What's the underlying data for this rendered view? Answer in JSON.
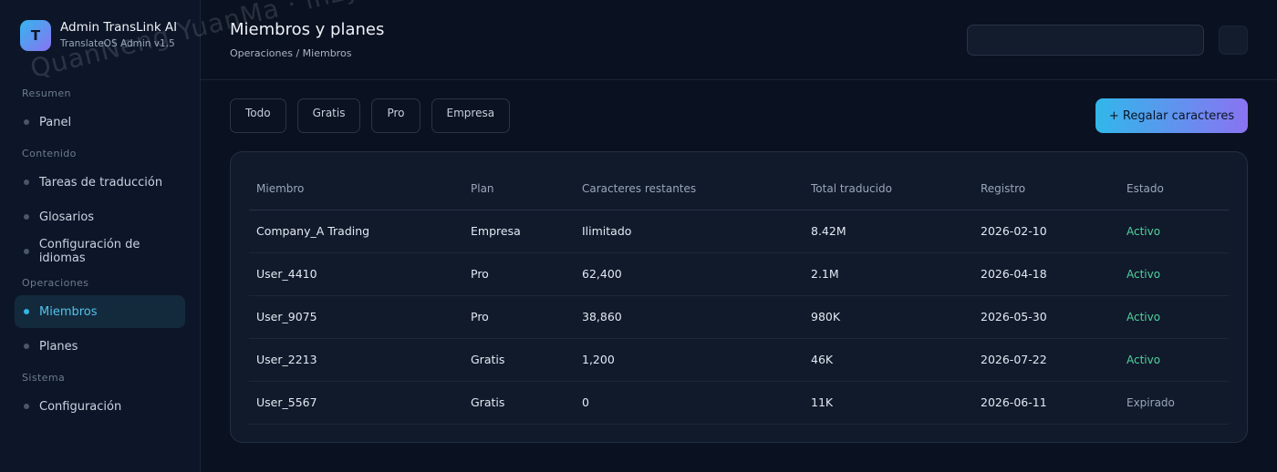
{
  "brand": {
    "logo_letter": "T",
    "title": "Admin TransLink AI",
    "subtitle": "TranslateOS Admin v1.5"
  },
  "sidebar": {
    "sections": [
      {
        "label": "Resumen",
        "items": [
          {
            "label": "Panel",
            "active": false
          }
        ]
      },
      {
        "label": "Contenido",
        "items": [
          {
            "label": "Tareas de traducción",
            "active": false
          },
          {
            "label": "Glosarios",
            "active": false
          },
          {
            "label": "Configuración de idiomas",
            "active": false
          }
        ]
      },
      {
        "label": "Operaciones",
        "items": [
          {
            "label": "Miembros",
            "active": true
          },
          {
            "label": "Planes",
            "active": false
          }
        ]
      },
      {
        "label": "Sistema",
        "items": [
          {
            "label": "Configuración",
            "active": false
          }
        ]
      }
    ]
  },
  "header": {
    "title": "Miembros y planes",
    "breadcrumb": "Operaciones / Miembros",
    "search_value": ""
  },
  "filters": [
    "Todo",
    "Gratis",
    "Pro",
    "Empresa"
  ],
  "gift_button_label": "+ Regalar caracteres",
  "table": {
    "columns": [
      "Miembro",
      "Plan",
      "Caracteres restantes",
      "Total traducido",
      "Registro",
      "Estado"
    ],
    "rows": [
      {
        "member": "Company_A Trading",
        "plan": "Empresa",
        "remaining": "Ilimitado",
        "total": "8.42M",
        "registered": "2026-02-10",
        "status": "Activo",
        "status_kind": "active"
      },
      {
        "member": "User_4410",
        "plan": "Pro",
        "remaining": "62,400",
        "total": "2.1M",
        "registered": "2026-04-18",
        "status": "Activo",
        "status_kind": "active"
      },
      {
        "member": "User_9075",
        "plan": "Pro",
        "remaining": "38,860",
        "total": "980K",
        "registered": "2026-05-30",
        "status": "Activo",
        "status_kind": "active"
      },
      {
        "member": "User_2213",
        "plan": "Gratis",
        "remaining": "1,200",
        "total": "46K",
        "registered": "2026-07-22",
        "status": "Activo",
        "status_kind": "active"
      },
      {
        "member": "User_5567",
        "plan": "Gratis",
        "remaining": "0",
        "total": "11K",
        "registered": "2026-06-11",
        "status": "Expirado",
        "status_kind": "expired"
      }
    ]
  },
  "colors": {
    "accent": "#35b5e8",
    "gradient_end": "#8a73f2",
    "active_status": "#4fd29c"
  },
  "watermark": "QuanNeng YuanMa · inzyxuashop.com"
}
